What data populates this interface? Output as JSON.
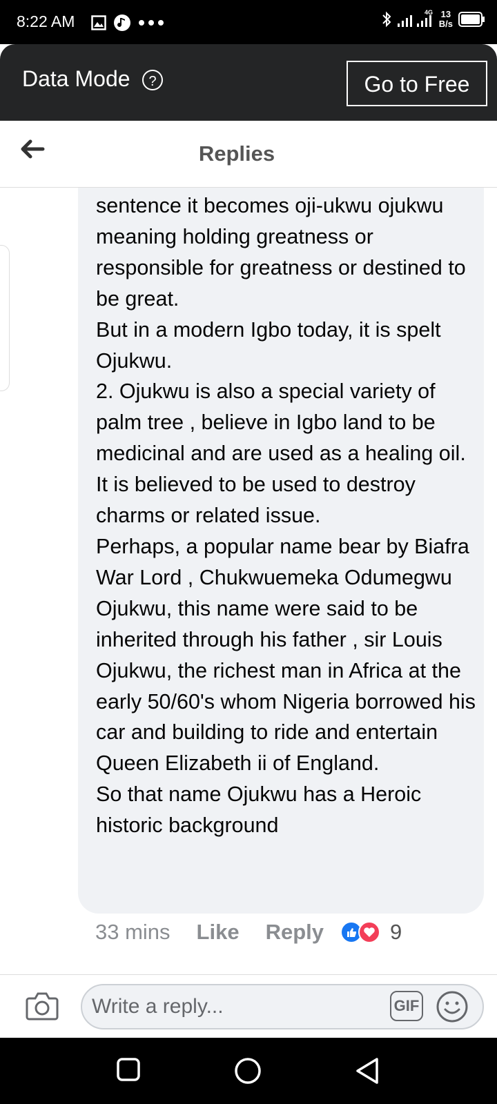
{
  "status_bar": {
    "time": "8:22 AM",
    "network_label": "4G",
    "speed_value": "13",
    "speed_unit": "B/s",
    "icons": [
      "gallery-icon",
      "music-icon",
      "more-dots-icon",
      "bluetooth-icon",
      "signal-icon",
      "battery-icon"
    ]
  },
  "data_bar": {
    "title": "Data Mode",
    "help_icon": "?",
    "go_free_label": "Go to Free"
  },
  "header": {
    "title": "Replies",
    "back_icon": "back-arrow-icon"
  },
  "comment": {
    "text": "sentence it becomes oji-ukwu ojukwu meaning holding greatness or responsible for greatness or destined to be great.\nBut in a modern Igbo today, it is spelt Ojukwu.\n2. Ojukwu is also a special variety of palm tree , believe in Igbo land to be medicinal and are used as a healing oil. It is believed to be used to destroy charms or related issue.\nPerhaps, a popular name bear by Biafra War Lord , Chukwuemeka Odumegwu Ojukwu, this name were said to be inherited through his father , sir Louis Ojukwu, the richest man in Africa at the early 50/60's whom Nigeria borrowed his car and building to ride and entertain Queen Elizabeth ii of England.\nSo that name Ojukwu has a Heroic historic background",
    "time": "33 mins",
    "like_label": "Like",
    "reply_label": "Reply",
    "reaction_count": "9",
    "reactions": [
      "like-reaction-icon",
      "love-reaction-icon"
    ]
  },
  "composer": {
    "placeholder": "Write a reply...",
    "gif_label": "GIF"
  },
  "colors": {
    "data_bar_bg": "#242526",
    "bubble_bg": "#f0f2f5",
    "like_blue": "#1877f2",
    "love_red": "#f33e58"
  }
}
